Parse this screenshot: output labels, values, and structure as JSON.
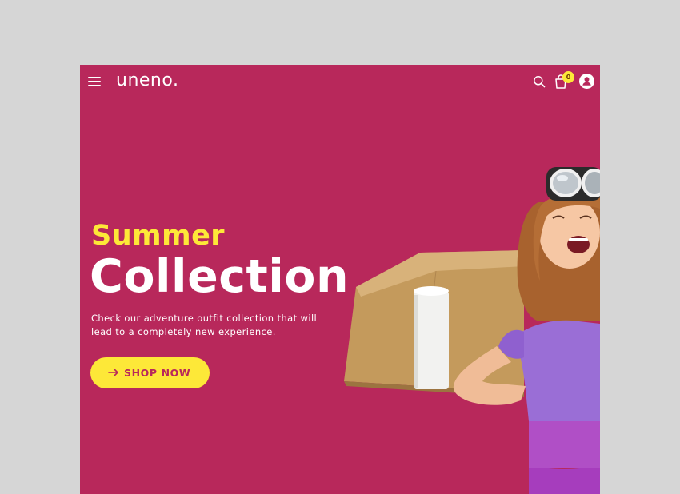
{
  "header": {
    "logo_text": "uneno.",
    "cart_count": "0"
  },
  "hero": {
    "title_line1": "Summer",
    "title_line2": "Collection",
    "description": "Check our adventure outfit collection that will lead to a completely new experience.",
    "cta_label": "SHOP NOW"
  },
  "colors": {
    "background": "#b8285b",
    "accent": "#fde838",
    "text": "#ffffff",
    "page_backdrop": "#d6d6d6"
  },
  "icons": {
    "menu": "hamburger-icon",
    "search": "search-icon",
    "cart": "shopping-bag-icon",
    "account": "user-icon",
    "cta": "arrow-right-icon"
  }
}
